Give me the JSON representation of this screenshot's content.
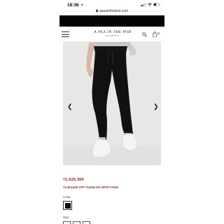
{
  "status_bar": {
    "time": "16:36",
    "url": "apeainthepod.com"
  },
  "header": {
    "brand_name": "A PEA IN THE POD",
    "brand_sub": "MATERNITY",
    "bag_count": "0"
  },
  "product": {
    "image_alt": "",
    "price": "₫1,629,300",
    "promo": "₫1,404,600 OFF ₫5,618,100 WITH CODE",
    "color_label": "Color",
    "size_label": "Size",
    "selected_color": "#0a0a0a"
  },
  "icons": {
    "menu": "hamburger-menu-icon",
    "search": "search-icon",
    "bag": "shopping-bag-icon",
    "prev": "chevron-left-icon",
    "next": "chevron-right-icon"
  },
  "colors": {
    "promo_red": "#a31b1b",
    "image_bg": "#e7e7e5",
    "band": "#050505"
  }
}
